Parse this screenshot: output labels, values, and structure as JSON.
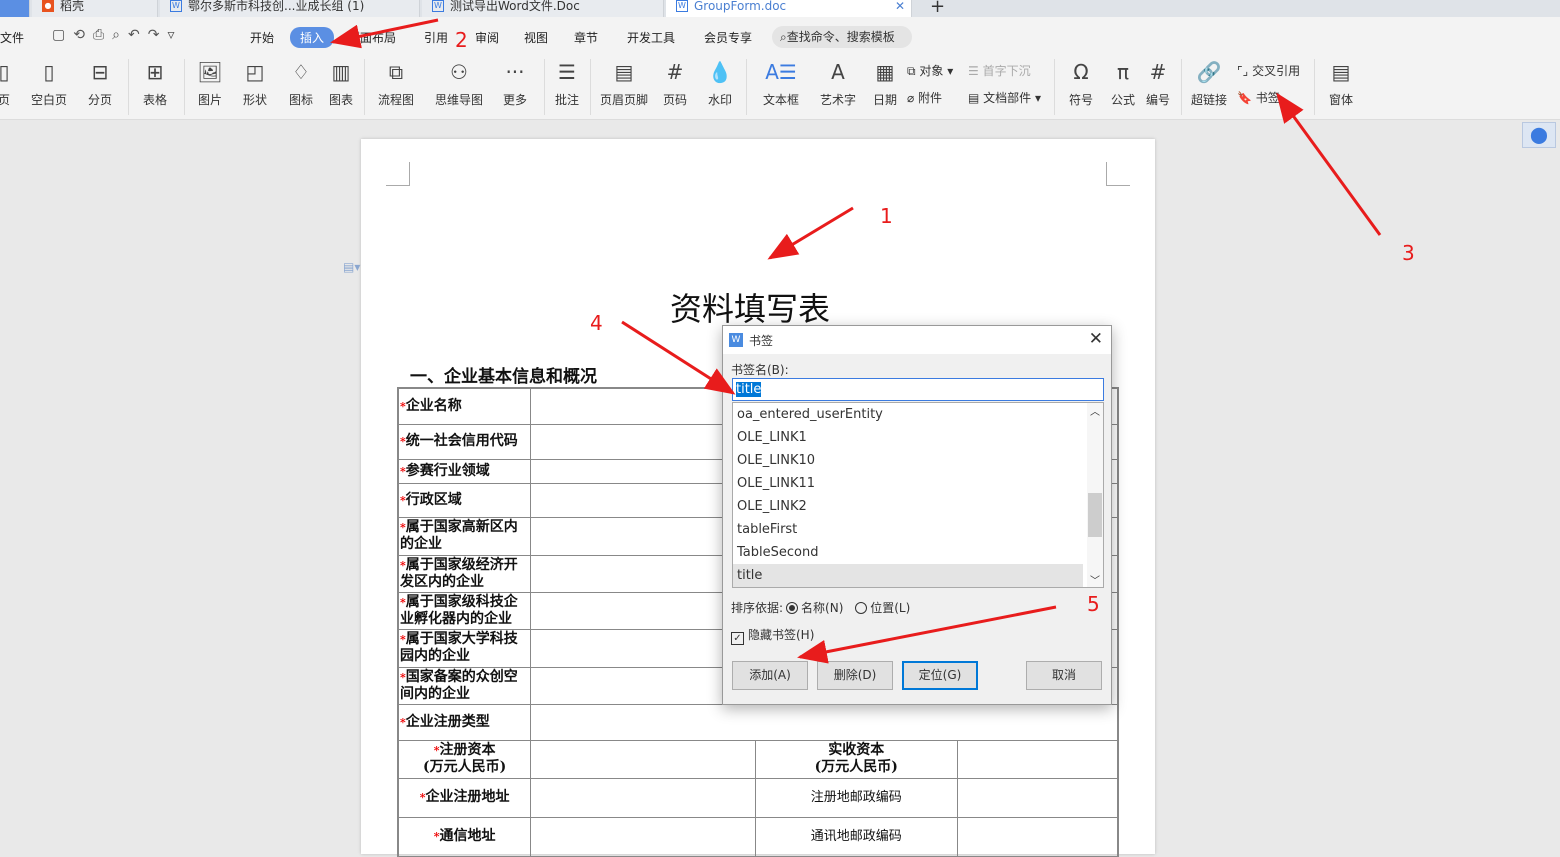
{
  "tabs": [
    {
      "label": "稻壳"
    },
    {
      "label": "鄂尔多斯市科技创...业成长组 (1)"
    },
    {
      "label": "测试导出Word文件.Doc"
    },
    {
      "label": "GroupForm.doc"
    }
  ],
  "menu": {
    "file": "文件",
    "items": [
      "开始",
      "插入",
      "页面布局",
      "引用",
      "审阅",
      "视图",
      "章节",
      "开发工具",
      "会员专享"
    ],
    "search_placeholder": "查找命令、搜索模板"
  },
  "ribbon": {
    "items": [
      "页",
      "空白页",
      "分页",
      "表格",
      "图片",
      "形状",
      "图标",
      "图表",
      "流程图",
      "思维导图",
      "更多",
      "批注",
      "页眉页脚",
      "页码",
      "水印",
      "文本框",
      "艺术字",
      "日期",
      "符号",
      "公式",
      "编号",
      "超链接",
      "窗体"
    ],
    "small": {
      "object": "对象",
      "dropcap": "首字下沉",
      "attachment": "附件",
      "docparts": "文档部件",
      "crossref": "交叉引用",
      "bookmark": "书签"
    }
  },
  "document": {
    "title": "资料填写表",
    "section": "一、企业基本信息和概况",
    "rows": [
      {
        "label": "企业名称"
      },
      {
        "label": "统一社会信用代码"
      },
      {
        "label": "参赛行业领域"
      },
      {
        "label": "行政区域"
      },
      {
        "label": "属于国家高新区内的企业"
      },
      {
        "label": "属于国家级经济开发区内的企业"
      },
      {
        "label": "属于国家级科技企业孵化器内的企业"
      },
      {
        "label": "属于国家大学科技园内的企业"
      },
      {
        "label": "国家备案的众创空间内的企业"
      },
      {
        "label": "企业注册类型"
      }
    ],
    "pair_rows": [
      {
        "left": "注册资本\n(万元人民币)",
        "right": "实收资本\n(万元人民币)"
      },
      {
        "left": "企业注册地址",
        "right": "注册地邮政编码"
      },
      {
        "left": "通信地址",
        "right": "通讯地邮政编码"
      }
    ],
    "required_mark": "*"
  },
  "dialog": {
    "title": "书签",
    "name_label": "书签名(B):",
    "name_value": "title",
    "bookmarks": [
      "oa_entered_userEntity",
      "OLE_LINK1",
      "OLE_LINK10",
      "OLE_LINK11",
      "OLE_LINK2",
      "tableFirst",
      "TableSecond",
      "title"
    ],
    "selected": "title",
    "sort_label": "排序依据:",
    "sort_name": "名称(N)",
    "sort_position": "位置(L)",
    "hide_label": "隐藏书签(H)",
    "hide_checked": true,
    "buttons": {
      "add": "添加(A)",
      "delete": "删除(D)",
      "goto": "定位(G)",
      "cancel": "取消"
    }
  },
  "annotations": [
    "1",
    "2",
    "3",
    "4",
    "5"
  ],
  "colors": {
    "accent": "#5b8fe3",
    "annotation": "#e81c1c"
  }
}
